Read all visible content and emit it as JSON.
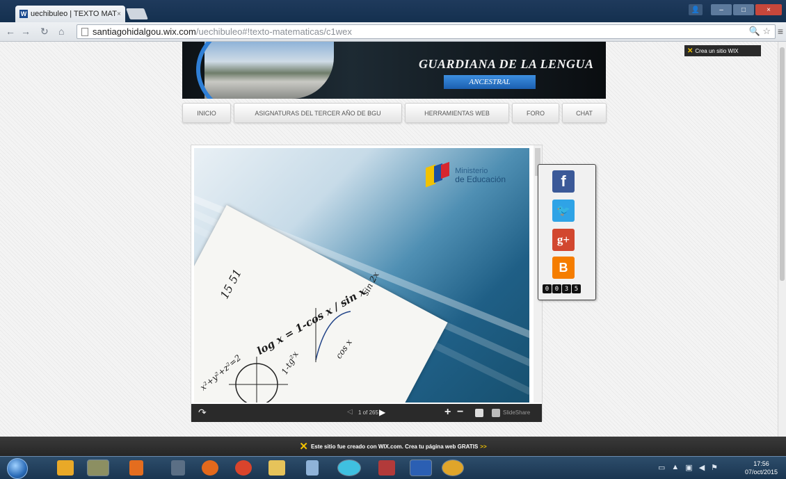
{
  "browser": {
    "tab_title": "uechibuleo | TEXTO MAT",
    "tab_favicon": "W",
    "url_host": "santiagohidalgou.wix.com",
    "url_path": "/uechibuleo#!texto-matematicas/c1wex"
  },
  "wix_badge": {
    "label": "Crea un sitio WIX"
  },
  "banner": {
    "title": "GUARDIANA DE LA LENGUA",
    "subtitle": "ANCESTRAL"
  },
  "nav": {
    "items": [
      {
        "label": "INICIO"
      },
      {
        "label": "ASIGNATURAS DEL TERCER AÑO DE BGU"
      },
      {
        "label": "HERRAMIENTAS WEB"
      },
      {
        "label": "FORO"
      },
      {
        "label": "CHAT"
      }
    ]
  },
  "slide": {
    "logo_line1": "Ministerio",
    "logo_line2": "de Educación",
    "formulas": [
      "15 51",
      "log x = 1-cos x / sin x",
      "sin 2x",
      "cos x",
      "1-tg²x",
      "x²+y²+z²=2"
    ]
  },
  "slideshare": {
    "pages": "1 of 265",
    "brand": "SlideShare"
  },
  "social": {
    "colors": {
      "facebook": "#3b5998",
      "twitter": "#2fa3e6",
      "googleplus": "#d2472f",
      "blogger": "#f57d00"
    },
    "counter": [
      "0",
      "0",
      "3",
      "5"
    ]
  },
  "wix_footer": {
    "text": "Este sitio fue creado con WIX.com. Crea tu página web GRATIS",
    "arrows": ">>"
  },
  "taskbar": {
    "time": "17:56",
    "date": "07/oct/2015"
  }
}
